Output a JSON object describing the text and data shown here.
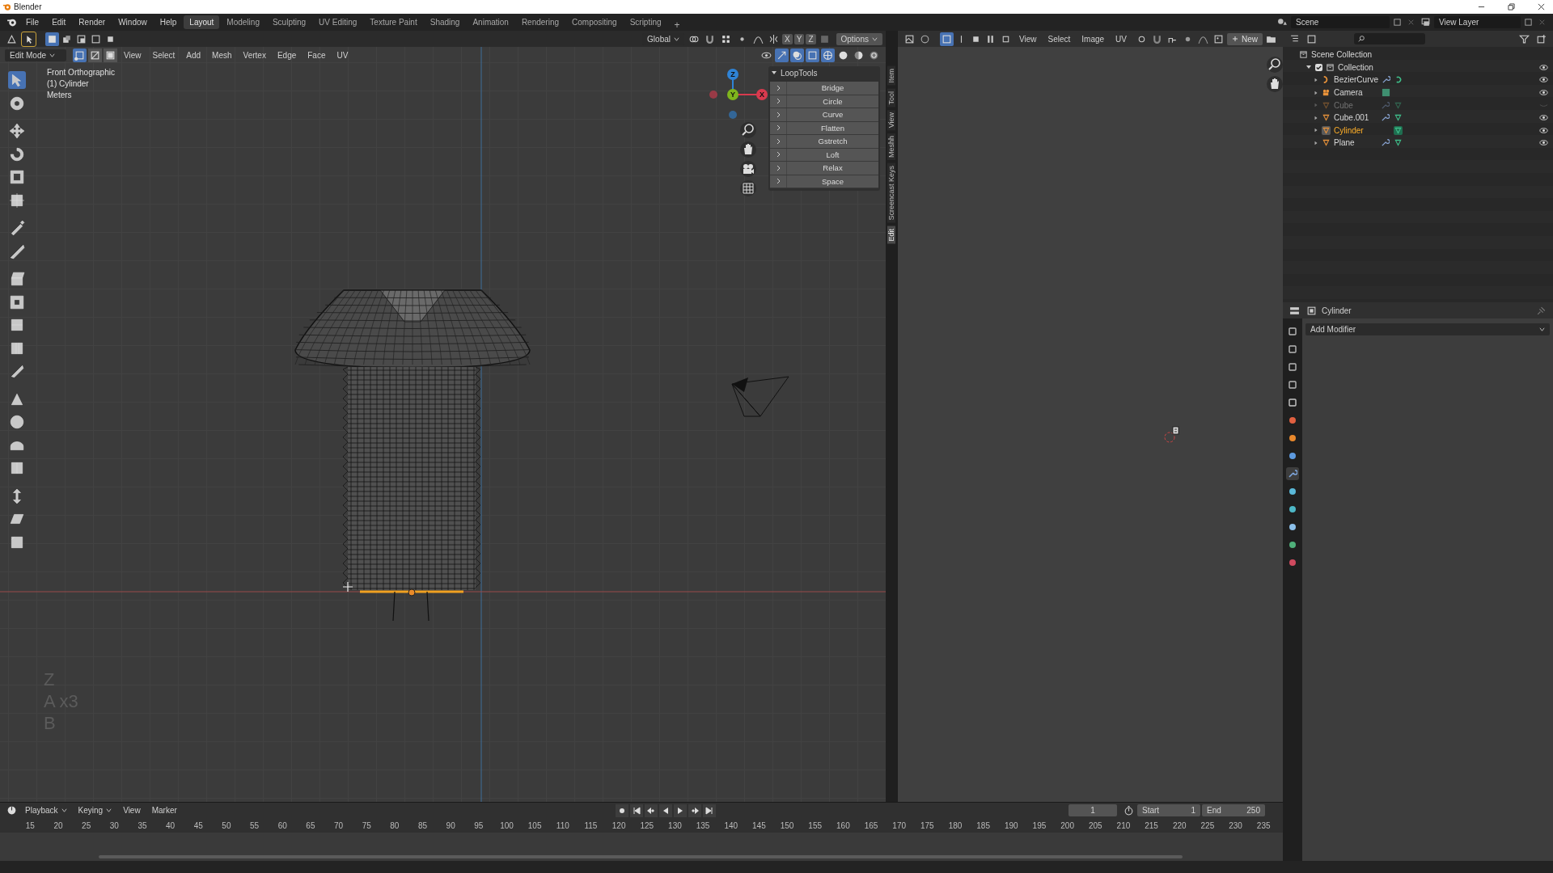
{
  "window": {
    "title": "Blender"
  },
  "menu": [
    "File",
    "Edit",
    "Render",
    "Window",
    "Help"
  ],
  "workspaces": [
    {
      "label": "Layout",
      "selected": true
    },
    {
      "label": "Modeling",
      "selected": false
    },
    {
      "label": "Sculpting",
      "selected": false
    },
    {
      "label": "UV Editing",
      "selected": false
    },
    {
      "label": "Texture Paint",
      "selected": false
    },
    {
      "label": "Shading",
      "selected": false
    },
    {
      "label": "Animation",
      "selected": false
    },
    {
      "label": "Rendering",
      "selected": false
    },
    {
      "label": "Compositing",
      "selected": false
    },
    {
      "label": "Scripting",
      "selected": false
    }
  ],
  "add_workspace": "+",
  "scene": "Scene",
  "view_layer": "View Layer",
  "tool_header": {
    "orientation": "Global"
  },
  "viewport_header": {
    "mode": "Edit Mode",
    "select_modes": [
      {
        "selected": true
      },
      {
        "selected": false
      },
      {
        "selected": false
      }
    ],
    "menus": [
      "View",
      "Select",
      "Add",
      "Mesh",
      "Vertex",
      "Edge",
      "Face",
      "UV"
    ],
    "axes": [
      "X",
      "Y",
      "Z"
    ],
    "options": "Options"
  },
  "viewport_info": [
    "Front Orthographic",
    "(1) Cylinder",
    "Meters"
  ],
  "toolbar": [
    {
      "selected": true
    },
    {
      "selected": false
    },
    {
      "selected": false
    },
    {
      "selected": false
    },
    {
      "selected": false
    },
    {
      "selected": false
    },
    {
      "selected": false
    },
    {
      "selected": false
    },
    {
      "selected": false
    },
    {
      "selected": false
    },
    {
      "selected": false
    },
    {
      "selected": false
    },
    {
      "selected": false
    },
    {
      "selected": false
    },
    {
      "selected": false
    },
    {
      "selected": false
    },
    {
      "selected": false
    },
    {
      "selected": false
    },
    {
      "selected": false
    },
    {
      "selected": false
    }
  ],
  "gizmo": [
    {
      "label": "X",
      "color": "#d83a4e"
    },
    {
      "label": "Y",
      "color": "#7fb51d"
    },
    {
      "label": "Z",
      "color": "#2f83d6"
    }
  ],
  "looptools": {
    "title": "LoopTools",
    "items": [
      "Bridge",
      "Circle",
      "Curve",
      "Flatten",
      "Gstretch",
      "Loft",
      "Relax",
      "Space"
    ]
  },
  "sidebar_tabs": [
    {
      "label": "Item",
      "selected": false
    },
    {
      "label": "Tool",
      "selected": false
    },
    {
      "label": "View",
      "selected": false
    },
    {
      "label": "Meshh",
      "selected": false
    },
    {
      "label": "Screencast Keys",
      "selected": false
    },
    {
      "label": "Edit",
      "selected": true
    }
  ],
  "screencast_keys": [
    "Z",
    "A x3",
    "B"
  ],
  "image_editor": {
    "menus": [
      "View",
      "Select",
      "Image",
      "UV"
    ],
    "new_button": "New"
  },
  "outliner": {
    "root": "Scene Collection",
    "collections": [
      {
        "name": "Collection",
        "checked": true,
        "expanded": true,
        "children": [
          {
            "name": "BezierCurve",
            "kind": "curve",
            "modifier": true,
            "selected": false,
            "visible": true
          },
          {
            "name": "Camera",
            "kind": "camera",
            "modifier": false,
            "selected": false,
            "visible": true
          },
          {
            "name": "Cube",
            "kind": "mesh",
            "modifier": true,
            "selected": false,
            "visible": false
          },
          {
            "name": "Cube.001",
            "kind": "mesh",
            "modifier": true,
            "selected": false,
            "visible": true
          },
          {
            "name": "Cylinder",
            "kind": "mesh",
            "modifier": false,
            "selected": true,
            "visible": true
          },
          {
            "name": "Plane",
            "kind": "mesh",
            "modifier": true,
            "selected": false,
            "visible": true
          }
        ]
      }
    ]
  },
  "properties": {
    "object": "Cylinder",
    "add_modifier": "Add Modifier",
    "tabs": [
      {
        "selected": false
      },
      {
        "selected": false
      },
      {
        "selected": false
      },
      {
        "selected": false
      },
      {
        "selected": false
      },
      {
        "selected": false
      },
      {
        "selected": false
      },
      {
        "selected": false
      },
      {
        "selected": true
      },
      {
        "selected": false
      },
      {
        "selected": false
      },
      {
        "selected": false
      },
      {
        "selected": false
      },
      {
        "selected": false
      }
    ]
  },
  "timeline": {
    "menus": [
      "Playback",
      "Keying",
      "View",
      "Marker"
    ],
    "current_frame": "1",
    "start_label": "Start",
    "start": "1",
    "end_label": "End",
    "end": "250",
    "ticks": [
      "15",
      "20",
      "25",
      "30",
      "35",
      "40",
      "45",
      "50",
      "55",
      "60",
      "65",
      "70",
      "75",
      "80",
      "85",
      "90",
      "95",
      "100",
      "105",
      "110",
      "115",
      "120",
      "125",
      "130",
      "135",
      "140",
      "145",
      "150",
      "155",
      "160",
      "165",
      "170",
      "175",
      "180",
      "185",
      "190",
      "195",
      "200",
      "205",
      "210",
      "215",
      "220",
      "225",
      "230",
      "235"
    ]
  }
}
